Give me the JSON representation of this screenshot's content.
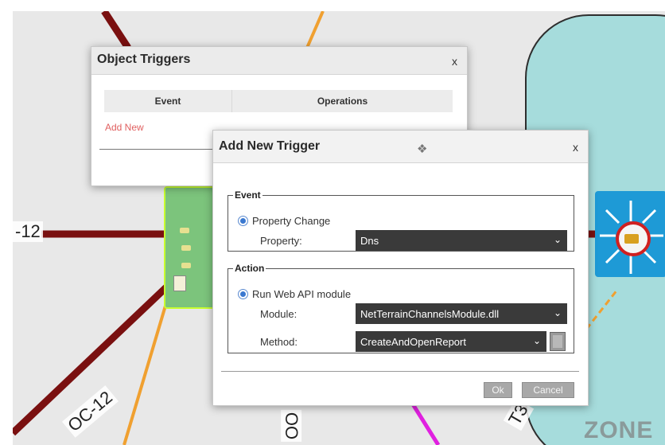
{
  "topology": {
    "zone_label": "ZONE",
    "link_labels": {
      "left": "-12",
      "bottom_left": "OC-12",
      "bottom_mid": "OO",
      "bottom_right": "T3"
    },
    "colors": {
      "canvas": "#e8e8e8",
      "zone_fill": "#a6dcdc",
      "link_dark_red": "#7a1010",
      "link_orange": "#f0a030",
      "link_magenta": "#e020e0",
      "device_green": "#7cc47c",
      "switch_blue": "#1e9ad6"
    }
  },
  "object_triggers": {
    "title": "Object Triggers",
    "close_label": "x",
    "columns": [
      "Event",
      "Operations"
    ],
    "add_new_label": "Add New"
  },
  "add_new_trigger": {
    "title": "Add New Trigger",
    "move_icon": "move-icon",
    "move_glyph": "❖",
    "close_label": "x",
    "event_group": {
      "legend": "Event",
      "radio_label": "Property Change",
      "property_label": "Property:",
      "property_value": "Dns"
    },
    "action_group": {
      "legend": "Action",
      "radio_label": "Run Web API module",
      "module_label": "Module:",
      "module_value": "NetTerrainChannelsModule.dll",
      "method_label": "Method:",
      "method_value": "CreateAndOpenReport"
    },
    "caret_glyph": "⌄",
    "ok_label": "Ok",
    "cancel_label": "Cancel"
  }
}
